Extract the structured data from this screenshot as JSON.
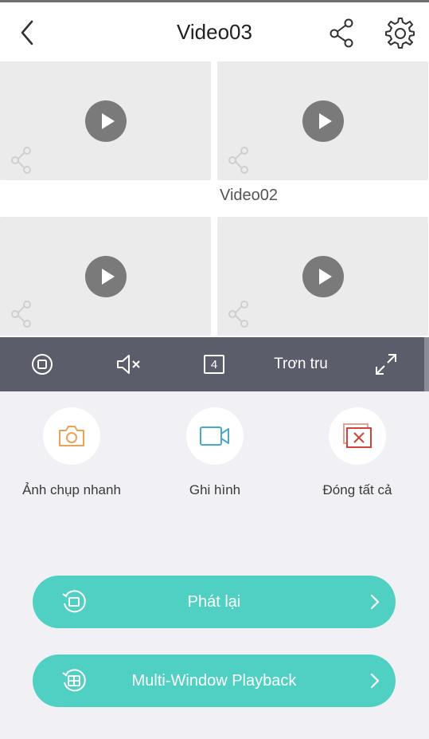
{
  "header": {
    "title": "Video03",
    "back_icon": "chevron-left-icon",
    "share_icon": "share-icon",
    "settings_icon": "gear-icon"
  },
  "grid": {
    "tiles": [
      {
        "label": ""
      },
      {
        "label": "Video02"
      },
      {
        "label": ""
      },
      {
        "label": ""
      }
    ]
  },
  "toolbar": {
    "stop_icon": "stop-icon",
    "mute_icon": "speaker-muted-icon",
    "split_count": "4",
    "quality": "Trơn tru",
    "fullscreen_icon": "fullscreen-icon"
  },
  "actions": [
    {
      "label": "Ảnh chụp nhanh",
      "icon": "camera-icon"
    },
    {
      "label": "Ghi hình",
      "icon": "video-camera-icon"
    },
    {
      "label": "Đóng tất cả",
      "icon": "close-all-icon"
    }
  ],
  "buttons": {
    "playback": "Phát lại",
    "multi_playback": "Multi-Window Playback"
  },
  "colors": {
    "accent": "#4fd0c2",
    "toolbar": "#5b5d6b",
    "snapshot_icon": "#e8a25a",
    "record_icon": "#4aa8c8",
    "close_icon": "#d0443a"
  }
}
